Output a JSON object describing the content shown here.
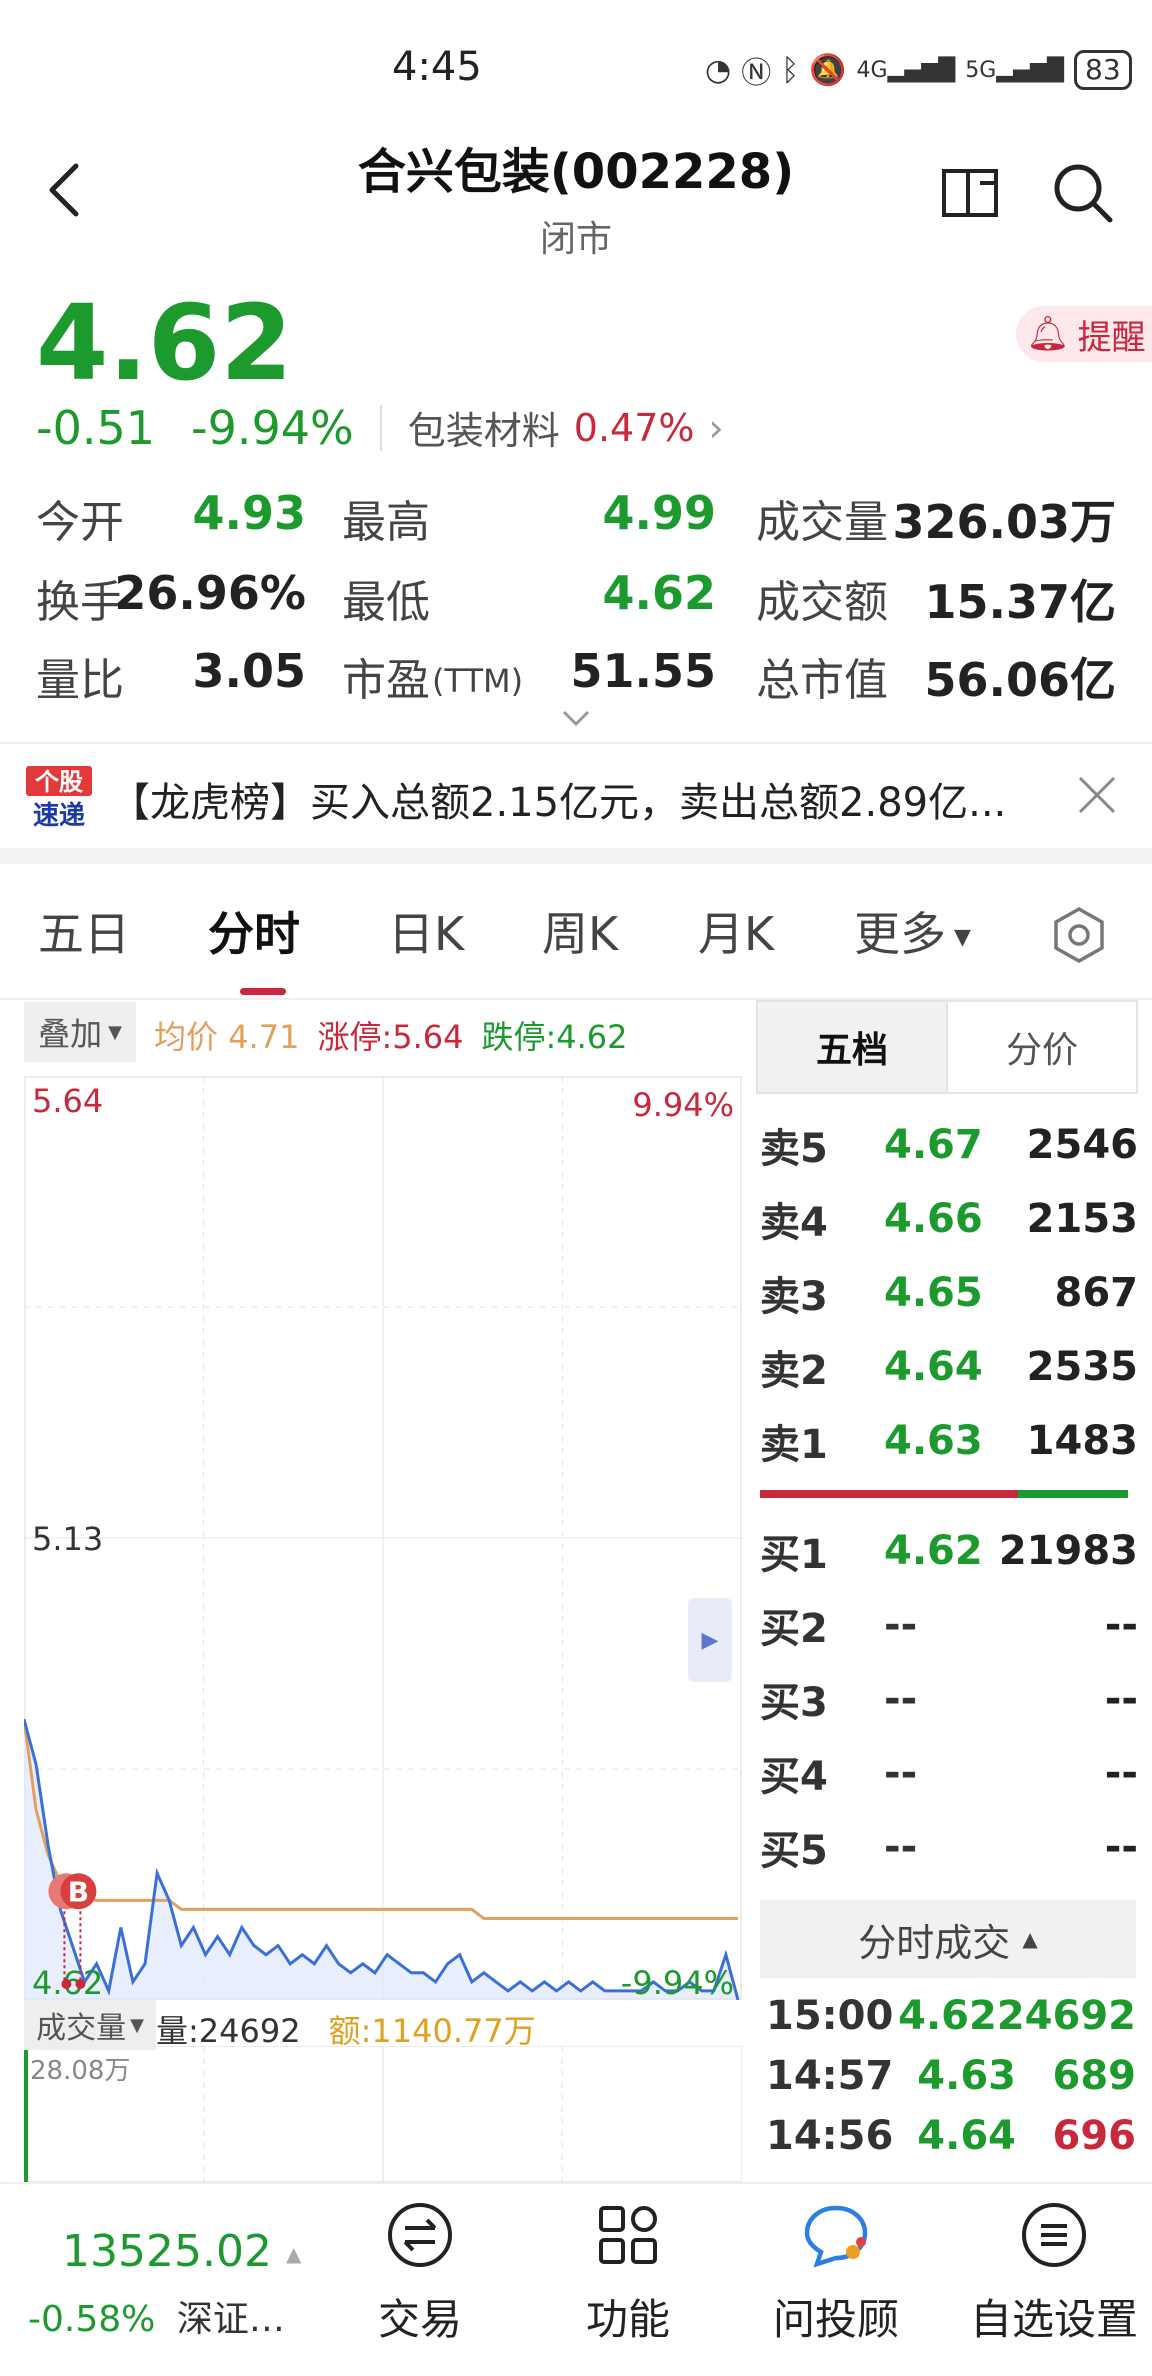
{
  "status_bar": {
    "time": "4:45",
    "battery": "83",
    "net1": "4G",
    "net2": "5G"
  },
  "header": {
    "title": "合兴包装(002228)",
    "subtitle": "闭市"
  },
  "quote": {
    "price": "4.62",
    "change": "-0.51",
    "change_pct": "-9.94%",
    "sector_name": "包装材料",
    "sector_pct": "0.47%",
    "alert_label": "提醒"
  },
  "stats": [
    {
      "label": "今开",
      "value": "4.93"
    },
    {
      "label": "最高",
      "value": "4.99"
    },
    {
      "label": "成交量",
      "value": "326.03万"
    },
    {
      "label": "换手",
      "value": "26.96%"
    },
    {
      "label": "最低",
      "value": "4.62"
    },
    {
      "label": "成交额",
      "value": "15.37亿"
    },
    {
      "label": "量比",
      "value": "3.05"
    },
    {
      "label": "市盈",
      "label_suffix": "(TTM)",
      "value": "51.55"
    },
    {
      "label": "总市值",
      "value": "56.06亿"
    }
  ],
  "news": {
    "badge_top": "个股",
    "badge_bottom": "速递",
    "text": "【龙虎榜】买入总额2.15亿元，卖出总额2.89亿..."
  },
  "tabs": [
    "五日",
    "分时",
    "日K",
    "周K",
    "月K",
    "更多"
  ],
  "chart_header": {
    "overlay": "叠加",
    "avg_label": "均价",
    "avg_value": "4.71",
    "limit_up": "涨停:5.64",
    "limit_down": "跌停:4.62"
  },
  "chart_data": {
    "type": "line",
    "y_labels": {
      "top": "5.64",
      "mid": "5.13",
      "bottom": "4.62",
      "top_pct": "9.94%",
      "bottom_pct": "-9.94%"
    },
    "ylim": [
      4.62,
      5.64
    ],
    "series_price": [
      4.93,
      4.88,
      4.79,
      4.72,
      4.68,
      4.64,
      4.66,
      4.63,
      4.7,
      4.64,
      4.66,
      4.76,
      4.73,
      4.68,
      4.7,
      4.67,
      4.69,
      4.67,
      4.7,
      4.68,
      4.67,
      4.68,
      4.66,
      4.67,
      4.66,
      4.68,
      4.66,
      4.65,
      4.66,
      4.65,
      4.67,
      4.66,
      4.65,
      4.65,
      4.64,
      4.66,
      4.67,
      4.64,
      4.65,
      4.64,
      4.63,
      4.64,
      4.63,
      4.64,
      4.63,
      4.64,
      4.63,
      4.64,
      4.63,
      4.63,
      4.63,
      4.63,
      4.64,
      4.63,
      4.63,
      4.64,
      4.63,
      4.63,
      4.67,
      4.62
    ],
    "series_avg": [
      4.93,
      4.83,
      4.78,
      4.75,
      4.74,
      4.73,
      4.73,
      4.73,
      4.73,
      4.73,
      4.73,
      4.73,
      4.73,
      4.72,
      4.72,
      4.72,
      4.72,
      4.72,
      4.72,
      4.72,
      4.72,
      4.72,
      4.72,
      4.72,
      4.72,
      4.72,
      4.72,
      4.72,
      4.72,
      4.72,
      4.72,
      4.72,
      4.72,
      4.72,
      4.72,
      4.72,
      4.72,
      4.72,
      4.71,
      4.71,
      4.71,
      4.71,
      4.71,
      4.71,
      4.71,
      4.71,
      4.71,
      4.71,
      4.71,
      4.71,
      4.71,
      4.71,
      4.71,
      4.71,
      4.71,
      4.71,
      4.71,
      4.71,
      4.71,
      4.71
    ],
    "marker": "B"
  },
  "volume_header": {
    "button": "成交量",
    "volume": "量:24692",
    "amount": "额:1140.77万",
    "max": "28.08万"
  },
  "order_book": {
    "tab_five": "五档",
    "tab_price": "分价",
    "asks": [
      {
        "label": "卖5",
        "price": "4.67",
        "vol": "2546"
      },
      {
        "label": "卖4",
        "price": "4.66",
        "vol": "2153"
      },
      {
        "label": "卖3",
        "price": "4.65",
        "vol": "867"
      },
      {
        "label": "卖2",
        "price": "4.64",
        "vol": "2535"
      },
      {
        "label": "卖1",
        "price": "4.63",
        "vol": "1483"
      }
    ],
    "bids": [
      {
        "label": "买1",
        "price": "4.62",
        "vol": "21983"
      },
      {
        "label": "买2",
        "price": "--",
        "vol": "--"
      },
      {
        "label": "买3",
        "price": "--",
        "vol": "--"
      },
      {
        "label": "买4",
        "price": "--",
        "vol": "--"
      },
      {
        "label": "买5",
        "price": "--",
        "vol": "--"
      }
    ]
  },
  "ticks": {
    "title": "分时成交",
    "rows": [
      {
        "time": "15:00",
        "price": "4.62",
        "vol": "24692"
      },
      {
        "time": "14:57",
        "price": "4.63",
        "vol": "689"
      },
      {
        "time": "14:56",
        "price": "4.64",
        "vol": "696"
      }
    ]
  },
  "bottom_nav": {
    "index_value": "13525.02",
    "index_change": "-0.58%",
    "index_name": "深证…",
    "items": [
      "交易",
      "功能",
      "问投顾",
      "自选设置"
    ]
  },
  "colors": {
    "up": "#c8283c",
    "down": "#1d9a2e",
    "price_line": "#3a6fd8",
    "avg_line": "#e0a060"
  }
}
